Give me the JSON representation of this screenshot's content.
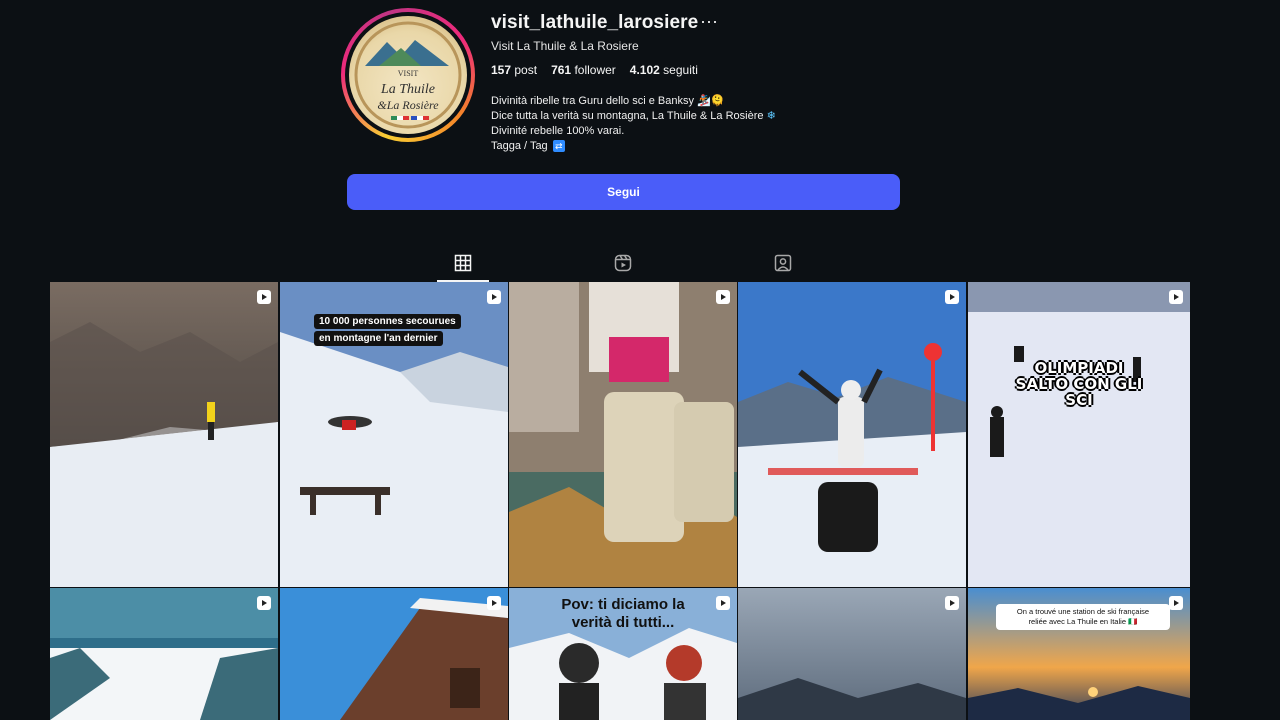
{
  "profile": {
    "username": "visit_lathuile_larosiere",
    "more_label": "···",
    "full_name": "Visit La Thuile & La Rosiere",
    "stats": [
      {
        "value": "157",
        "label": "post"
      },
      {
        "value": "761",
        "label": "follower"
      },
      {
        "value": "4.102",
        "label": "seguiti"
      }
    ],
    "bio": [
      "Divinità ribelle tra Guru dello sci e Banksy 🏂🫠",
      "Dice tutta la verità su montagna, La Thuile & La Rosière",
      "Divinité rebelle 100% varai.",
      "Tagga / Tag"
    ],
    "avatar_text": {
      "line1": "VISIT",
      "line2": "La Thuile",
      "line3": "&La Rosière"
    }
  },
  "follow_button": {
    "label": "Segui"
  },
  "tabs": [
    {
      "name": "posts",
      "icon": "grid-icon",
      "active": true
    },
    {
      "name": "reels",
      "icon": "reels-icon",
      "active": false
    },
    {
      "name": "tagged",
      "icon": "tagged-icon",
      "active": false
    }
  ],
  "posts": [
    {
      "id": 1,
      "overlay": ""
    },
    {
      "id": 2,
      "overlay": "10 000 personnes secourues en montagne l'an dernier"
    },
    {
      "id": 3,
      "overlay": ""
    },
    {
      "id": 4,
      "overlay": ""
    },
    {
      "id": 5,
      "overlay": "OLIMPIADI SALTO CON GLI SCI"
    },
    {
      "id": 6,
      "overlay": ""
    },
    {
      "id": 7,
      "overlay": ""
    },
    {
      "id": 8,
      "overlay": "Pov: ti diciamo la verità di tutti..."
    },
    {
      "id": 9,
      "overlay": ""
    },
    {
      "id": 10,
      "overlay": "On a trouvé une station de ski française reliée avec La Thuile en Italie 🇮🇹"
    }
  ],
  "post2": {
    "line1": "10 000 personnes secourues",
    "line2": "en montagne l'an dernier"
  },
  "post5": {
    "line1": "OLIMPIADI",
    "line2": "SALTO CON GLI",
    "line3": "SCI"
  },
  "post8": {
    "line1": "Pov: ti diciamo la",
    "line2": "verità di tutti..."
  },
  "post10": {
    "line1": "On a trouvé une station de ski française",
    "line2": "reliée avec La Thuile en Italie 🇮🇹"
  },
  "colors": {
    "background": "#0c1014",
    "follow": "#4a5df9",
    "text": "#f5f5f5"
  }
}
